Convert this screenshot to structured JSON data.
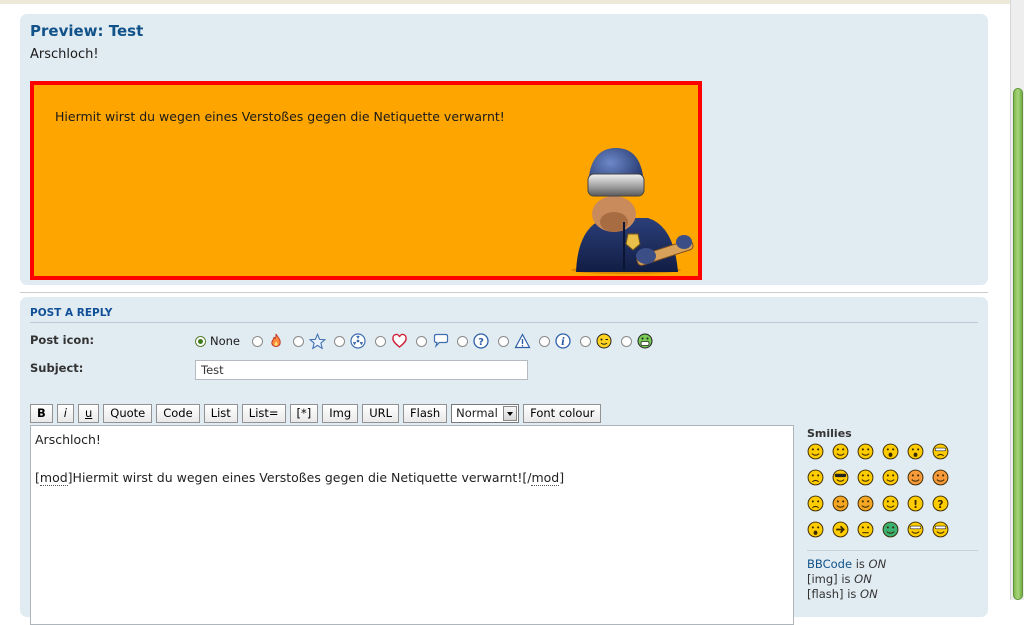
{
  "preview": {
    "title": "Preview: Test",
    "body_text": "Arschloch!",
    "mod_message": "Hiermit wirst du wegen eines Verstoßes gegen die Netiquette verwarnt!"
  },
  "reply": {
    "header": "POST A REPLY",
    "post_icon_label": "Post icon:",
    "none_label": "None",
    "post_icons": [
      "flame-icon",
      "star-icon",
      "radioactive-icon",
      "heart-icon",
      "speech-bubble-icon",
      "question-icon",
      "warning-icon",
      "info-icon",
      "wink-smiley-icon",
      "grin-smiley-icon"
    ],
    "subject_label": "Subject:",
    "subject_value": "Test",
    "toolbar": {
      "bold": "B",
      "italic": "i",
      "underline": "u",
      "quote": "Quote",
      "code": "Code",
      "list": "List",
      "list_ordered": "List=",
      "list_item": "[*]",
      "img": "Img",
      "url": "URL",
      "flash": "Flash",
      "font_size": "Normal",
      "font_colour": "Font colour"
    },
    "message": {
      "line1": "Arschloch!",
      "tag_open": "[mod]",
      "mod_open_word": "mod",
      "body": "Hiermit wirst du wegen eines Verstoßes gegen die Netiquette verwarnt!",
      "mod_close_word": "mod"
    },
    "smilies_title": "Smilies",
    "status": {
      "bbcode_link": "BBCode",
      "bbcode_state": "ON",
      "img_label": "[img]",
      "img_state": "ON",
      "flash_label": "[flash]",
      "flash_state": "ON",
      "is_word": "is"
    }
  },
  "colors": {
    "panel_bg": "#e1ebf2",
    "title_blue": "#105289",
    "mod_box_bg": "#ffa500",
    "mod_box_border": "#ff0000",
    "smiley_yellow": "#ffcc00"
  }
}
